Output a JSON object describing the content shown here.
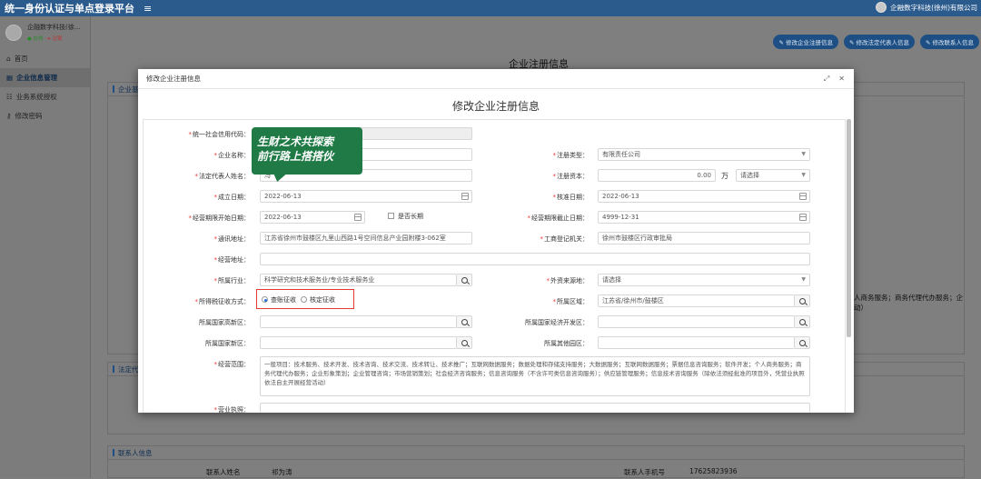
{
  "app": {
    "title": "统一身份认证与单点登录平台",
    "menu_icon": "hamburger-icon",
    "user": "企融数字科技(徐州)有限公司"
  },
  "sidebar": {
    "user_name": "企融数字科技(徐...",
    "status_online": "● 在线",
    "status_logout": "➔ 注销",
    "items": [
      {
        "label": "首页",
        "icon": "home-icon"
      },
      {
        "label": "企业信息管理",
        "icon": "building-icon"
      },
      {
        "label": "业务系统授权",
        "icon": "users-icon"
      },
      {
        "label": "修改密码",
        "icon": "key-icon"
      }
    ]
  },
  "main": {
    "buttons": [
      "修改企业注册信息",
      "修改法定代表人信息",
      "修改联系人信息"
    ],
    "page_title": "企业注册信息",
    "section1": "企业基本",
    "section2": "法定代表",
    "bg_text": "人商务服务；商务代理代办服务；企\n动）",
    "contact": {
      "title": "联系人信息",
      "name_label": "联系人姓名",
      "name": "祁为涛",
      "phone_label": "联系人手机号",
      "phone": "17625823936"
    }
  },
  "modal": {
    "header_title": "修改企业注册信息",
    "form_title": "修改企业注册信息",
    "fields": {
      "credit_code": {
        "label": "统一社会信用代码："
      },
      "company_name": {
        "label": "企业名称："
      },
      "reg_type": {
        "label": "注册类型：",
        "value": "有限责任公司"
      },
      "legal_rep": {
        "label": "法定代表人姓名：",
        "value": "冯"
      },
      "capital": {
        "label": "注册资本：",
        "value": "0.00",
        "unit": "万",
        "currency": "请选择"
      },
      "found_date": {
        "label": "成立日期：",
        "value": "2022-06-13"
      },
      "approve_date": {
        "label": "核准日期：",
        "value": "2022-06-13"
      },
      "op_start": {
        "label": "经营期限开始日期：",
        "value": "2022-06-13",
        "long_term": "是否长期"
      },
      "op_end": {
        "label": "经营期限截止日期：",
        "value": "4999-12-31"
      },
      "address": {
        "label": "通讯地址：",
        "value": "江苏省徐州市鼓楼区九里山西路1号空间信息产业园附楼3-062室"
      },
      "reg_authority": {
        "label": "工商登记机关：",
        "value": "徐州市鼓楼区行政审批局"
      },
      "biz_address": {
        "label": "经营地址："
      },
      "industry": {
        "label": "所属行业：",
        "value": "科学研究和技术服务业/专业技术服务业"
      },
      "foreign_source": {
        "label": "外资来源地：",
        "value": "请选择"
      },
      "tax_method": {
        "label": "所得税征收方式：",
        "opt1": "查账征收",
        "opt2": "核定征收"
      },
      "region": {
        "label": "所属区域：",
        "value": "江苏省/徐州市/鼓楼区"
      },
      "hitech_zone": {
        "label": "所属国家高新区："
      },
      "econ_zone": {
        "label": "所属国家经济开发区："
      },
      "nat_zone": {
        "label": "所属国家新区："
      },
      "other_zone": {
        "label": "所属其他园区："
      },
      "scope": {
        "label": "经营范围：",
        "value": "一般项目：技术服务、技术开发、技术咨询、技术交流、技术转让、技术推广；互联网数据服务；数据处理和存储支持服务；大数据服务；互联网数据服务；票据信息咨询服务；软件开发；个人商务服务；商务代理代办服务；企业形象策划；企业管理咨询；市场营销策划；社会经济咨询服务；信息咨询服务（不含许可类信息咨询服务）；供应链管理服务；信息技术咨询服务（除依法须经批准的项目外，凭营业执照依法自主开展经营活动）"
      },
      "license": {
        "label": "营业执照："
      }
    }
  },
  "sticker": {
    "line1": "生财之术共探索",
    "line2": "前行路上搭搭伙"
  }
}
